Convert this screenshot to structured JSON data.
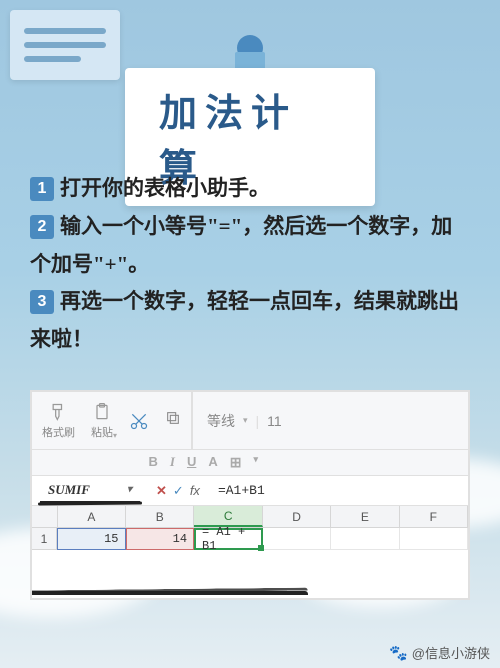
{
  "title": "加法计算",
  "steps": [
    {
      "num": "1",
      "text": "打开你的表格小助手。"
    },
    {
      "num": "2",
      "text": "输入一个小等号\"=\"，然后选一个数字，加个加号\"+\"。"
    },
    {
      "num": "3",
      "text": "再选一个数字，轻轻一点回车，结果就跳出来啦！"
    }
  ],
  "ribbon": {
    "format_painter": "格式刷",
    "paste": "粘贴",
    "font_name": "等线",
    "font_size": "11",
    "bold": "B",
    "italic": "I",
    "underline": "U",
    "font_color": "A"
  },
  "formula_bar": {
    "name_box": "SUMIF",
    "cancel": "✕",
    "enter": "✓",
    "fx_label": "fx",
    "formula": "=A1+B1"
  },
  "grid": {
    "columns": [
      "A",
      "B",
      "C",
      "D",
      "E",
      "F"
    ],
    "row1_num": "1",
    "cells": {
      "A1": "15",
      "B1": "14",
      "C1": "= A1 + B1"
    }
  },
  "watermark": "@信息小游侠"
}
